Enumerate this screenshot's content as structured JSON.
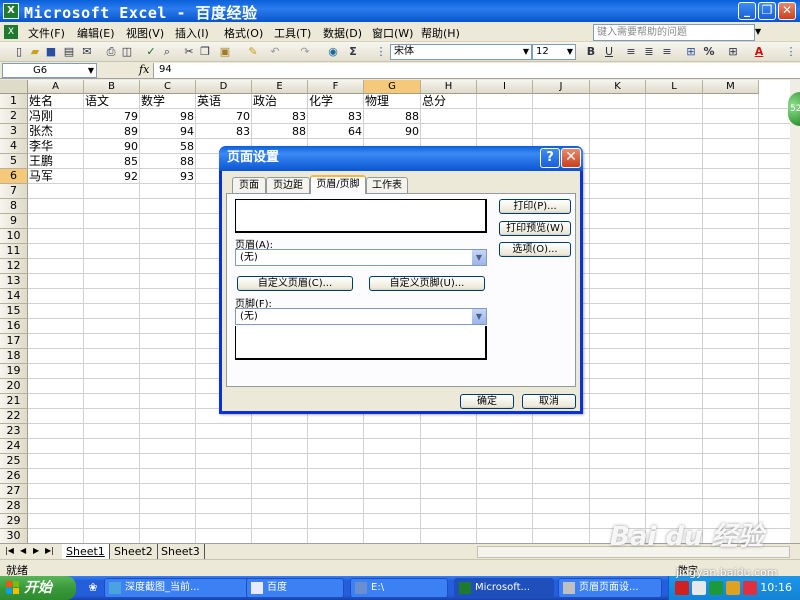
{
  "window": {
    "title": "Microsoft Excel - 百度经验",
    "app_icon": "X",
    "minimize": "_",
    "restore": "❐",
    "close": "✕"
  },
  "menu": {
    "items": [
      "文件(F)",
      "编辑(E)",
      "视图(V)",
      "插入(I)",
      "格式(O)",
      "工具(T)",
      "数据(D)",
      "窗口(W)",
      "帮助(H)"
    ],
    "help_placeholder": "键入需要帮助的问题"
  },
  "toolbar": {
    "font_name": "宋体",
    "font_size": "12",
    "bold": "B",
    "underline": "U",
    "percent": "%"
  },
  "formula_bar": {
    "cell_ref": "G6",
    "fx": "fx",
    "value": "94"
  },
  "sheet": {
    "columns": [
      "A",
      "B",
      "C",
      "D",
      "E",
      "F",
      "G",
      "H",
      "I",
      "J",
      "K",
      "L",
      "M"
    ],
    "selected_column": "G",
    "selected_row": 6,
    "row_count": 30,
    "headers": [
      "姓名",
      "语文",
      "数学",
      "英语",
      "政治",
      "化学",
      "物理",
      "总分"
    ],
    "rows": [
      [
        "冯刚",
        "79",
        "98",
        "70",
        "83",
        "83",
        "88",
        ""
      ],
      [
        "张杰",
        "89",
        "94",
        "83",
        "88",
        "64",
        "90",
        ""
      ],
      [
        "李华",
        "90",
        "58",
        "",
        "",
        "",
        "",
        ""
      ],
      [
        "王鹏",
        "85",
        "88",
        "",
        "",
        "",
        "",
        ""
      ],
      [
        "马军",
        "92",
        "93",
        "",
        "",
        "",
        "",
        ""
      ]
    ],
    "scroll_badge": "52"
  },
  "tabs": {
    "sheets": [
      "Sheet1",
      "Sheet2",
      "Sheet3"
    ],
    "active": "Sheet1"
  },
  "status": {
    "left": "就绪",
    "mode": "数字"
  },
  "taskbar": {
    "start": "开始",
    "tasks": [
      "深度截图_当前...",
      "百度",
      "E:\\",
      "Microsoft...",
      "页眉页面设..."
    ],
    "time": "10:16"
  },
  "dialog": {
    "title": "页面设置",
    "help": "?",
    "close": "✕",
    "tabs": [
      "页面",
      "页边距",
      "页眉/页脚",
      "工作表"
    ],
    "active_tab": "页眉/页脚",
    "header_label": "页眉(A):",
    "header_value": "(无)",
    "custom_header": "自定义页眉(C)...",
    "custom_footer": "自定义页脚(U)...",
    "footer_label": "页脚(F):",
    "footer_value": "(无)",
    "print": "打印(P)...",
    "print_preview": "打印预览(W)",
    "options": "选项(O)...",
    "ok": "确定",
    "cancel": "取消"
  },
  "watermark": {
    "brand": "Bai du 经验",
    "url": "jingyan.baidu.com"
  }
}
